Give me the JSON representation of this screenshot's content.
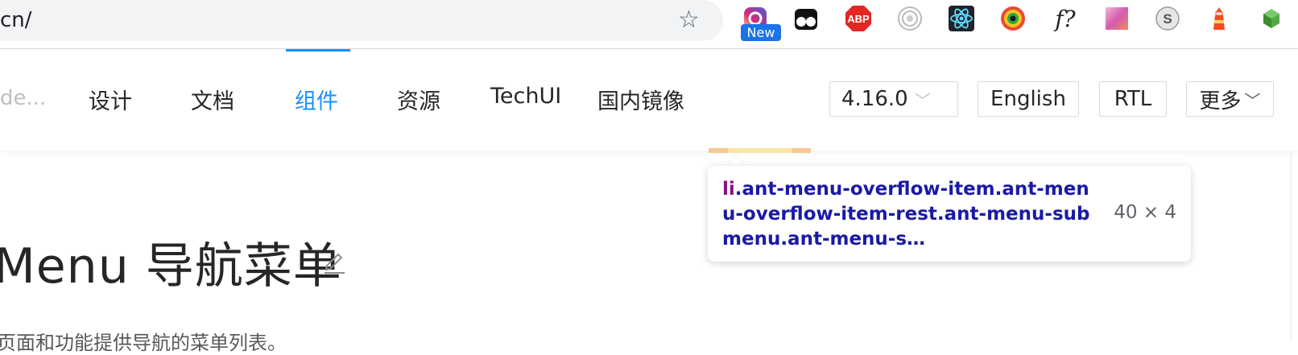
{
  "browser": {
    "url": "cn/",
    "new_badge": "New",
    "extensions": [
      {
        "name": "instagram-camera-icon"
      },
      {
        "name": "tampermonkey-icon"
      },
      {
        "name": "adblock-plus-icon",
        "label": "ABP"
      },
      {
        "name": "target-rings-icon"
      },
      {
        "name": "react-devtools-icon"
      },
      {
        "name": "colorful-eye-icon"
      },
      {
        "name": "font-finder-icon",
        "label": "f?"
      },
      {
        "name": "gradient-grid-icon"
      },
      {
        "name": "s-circle-icon",
        "label": "S"
      },
      {
        "name": "lighthouse-icon"
      },
      {
        "name": "green-cube-icon"
      }
    ]
  },
  "header": {
    "search_placeholder_trunc": "de...",
    "nav": [
      "设计",
      "文档",
      "组件",
      "资源",
      "TechUI",
      "国内镜像"
    ],
    "active_nav": "组件",
    "version": "4.16.0",
    "language": "English",
    "direction": "RTL",
    "more": "更多"
  },
  "page": {
    "title": "Menu 导航菜单",
    "description": "页面和功能提供导航的菜单列表。"
  },
  "inspector_tooltip": {
    "tag": "li",
    "classes": ".ant-menu-overflow-item.ant-menu-overflow-item-rest.ant-menu-submenu.ant-menu-s…",
    "size": "40 × 4"
  },
  "colors": {
    "primary": "#1890ff",
    "tooltip_class": "#1a1aa6",
    "tooltip_tag": "#881280",
    "highlight_margin": "#f6c897",
    "highlight_content": "#f9e6a8"
  }
}
